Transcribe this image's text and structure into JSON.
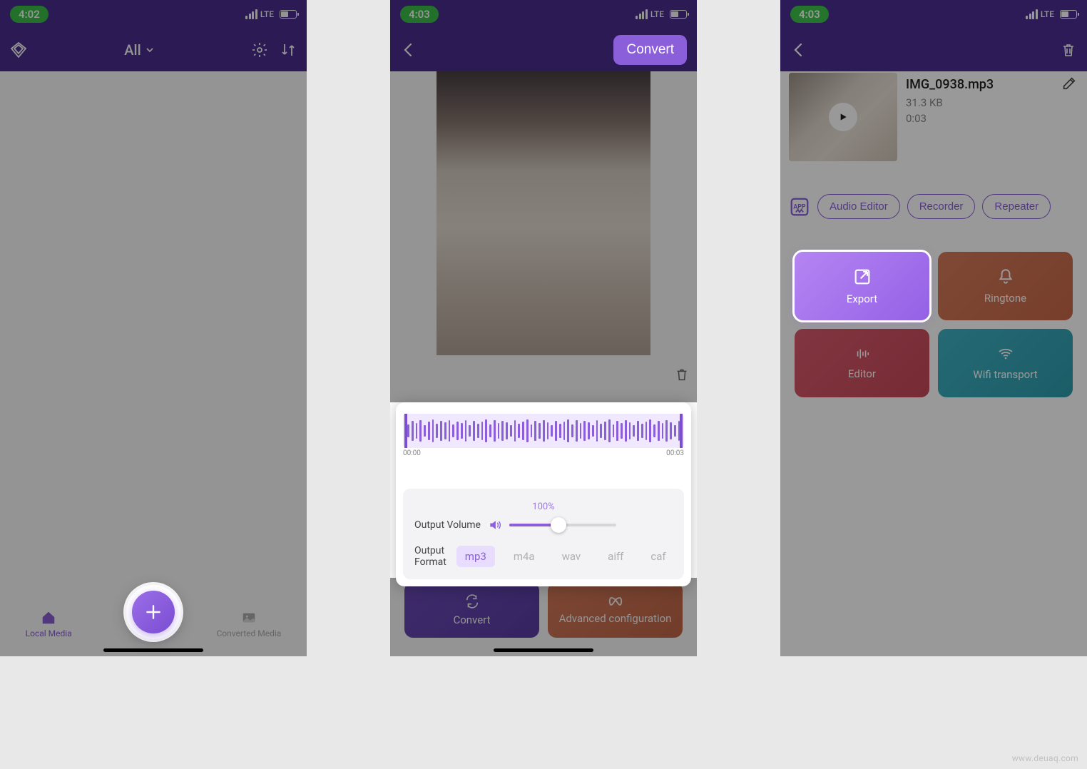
{
  "watermark": "www.deuaq.com",
  "screen1": {
    "time": "4:02",
    "lte": "LTE",
    "filter": "All",
    "tabs": {
      "local": "Local Media",
      "converted": "Converted Media"
    }
  },
  "screen2": {
    "time": "4:03",
    "lte": "LTE",
    "convert_btn": "Convert",
    "wave": {
      "start": "00:00",
      "end": "00:03"
    },
    "volume": {
      "label": "Output Volume",
      "percent": "100%"
    },
    "format": {
      "label": "Output Format",
      "options": [
        "mp3",
        "m4a",
        "wav",
        "aiff",
        "caf"
      ],
      "selected": "mp3"
    },
    "buttons": {
      "convert": "Convert",
      "advanced": "Advanced configuration"
    }
  },
  "screen3": {
    "time": "4:03",
    "lte": "LTE",
    "file": {
      "name": "IMG_0938.mp3",
      "size": "31.3 KB",
      "duration": "0:03"
    },
    "pills": {
      "audio_editor": "Audio Editor",
      "recorder": "Recorder",
      "repeater": "Repeater"
    },
    "cards": {
      "export": "Export",
      "ringtone": "Ringtone",
      "editor": "Editor",
      "wifi": "Wifi transport"
    }
  }
}
